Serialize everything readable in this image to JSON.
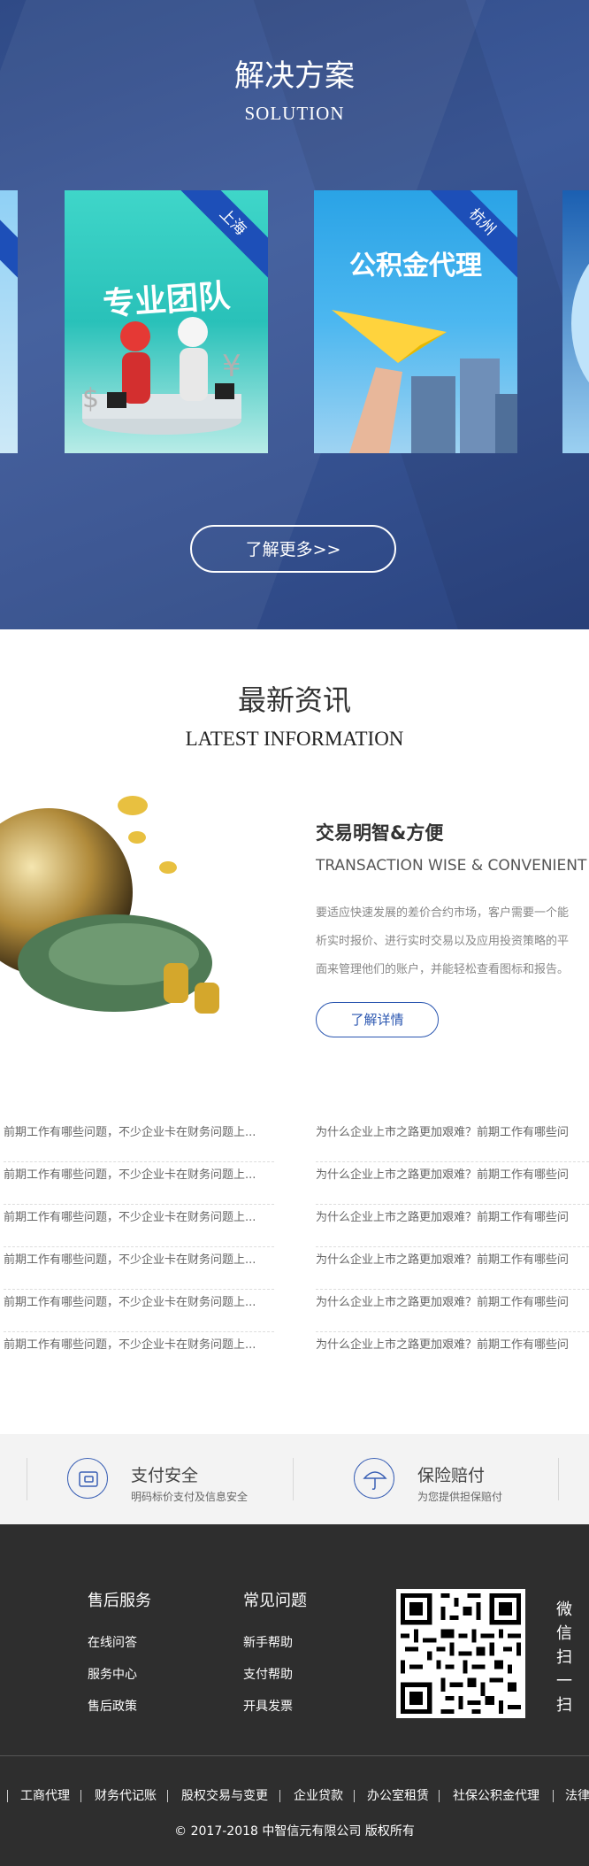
{
  "solution": {
    "title": "解决方案",
    "subtitle": "SOLUTION",
    "cards": [
      {
        "tag": "上海",
        "caption": "专业团队"
      },
      {
        "tag": "杭州",
        "caption": "公积金代理"
      }
    ],
    "more_label": "了解更多>>"
  },
  "news": {
    "title": "最新资讯",
    "subtitle": "LATEST INFORMATION",
    "featured": {
      "heading": "交易明智&方便",
      "en": "TRANSACTION WISE & CONVENIENT",
      "lines": [
        "要适应快速发展的差价合约市场，客户需要一个能",
        "析实时报价、进行实时交易以及应用投资策略的平",
        "面来管理他们的账户，并能轻松查看图标和报告。"
      ],
      "detail_label": "了解详情"
    },
    "left_list": [
      "前期工作有哪些问题，不少企业卡在财务问题上...",
      "前期工作有哪些问题，不少企业卡在财务问题上...",
      "前期工作有哪些问题，不少企业卡在财务问题上...",
      "前期工作有哪些问题，不少企业卡在财务问题上...",
      "前期工作有哪些问题，不少企业卡在财务问题上...",
      "前期工作有哪些问题，不少企业卡在财务问题上..."
    ],
    "right_list": [
      "为什么企业上市之路更加艰难？前期工作有哪些问",
      "为什么企业上市之路更加艰难？前期工作有哪些问",
      "为什么企业上市之路更加艰难？前期工作有哪些问",
      "为什么企业上市之路更加艰难？前期工作有哪些问",
      "为什么企业上市之路更加艰难？前期工作有哪些问",
      "为什么企业上市之路更加艰难？前期工作有哪些问"
    ]
  },
  "features": [
    {
      "icon": "wallet-icon",
      "title": "支付安全",
      "desc": "明码标价支付及信息安全"
    },
    {
      "icon": "umbrella-icon",
      "title": "保险赔付",
      "desc": "为您提供担保赔付"
    }
  ],
  "footer": {
    "col1": {
      "title": "售后服务",
      "links": [
        "在线问答",
        "服务中心",
        "售后政策"
      ]
    },
    "col2": {
      "title": "常见问题",
      "links": [
        "新手帮助",
        "支付帮助",
        "开具发票"
      ]
    },
    "scan_label": [
      "微",
      "信",
      "扫",
      "一",
      "扫"
    ],
    "links": [
      "工商代理",
      "财务代记账",
      "股权交易与变更",
      "企业贷款",
      "办公室租赁",
      "社保公积金代理",
      "法律"
    ],
    "copyright": "© 2017-2018 中智信元有限公司 版权所有"
  },
  "colors": {
    "accent": "#2a56b0",
    "banner": "#34508f",
    "footer": "#2e2e2e"
  }
}
